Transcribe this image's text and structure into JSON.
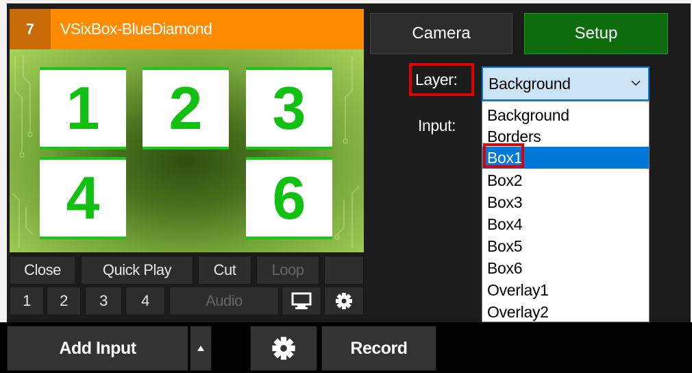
{
  "input_panel": {
    "number": "7",
    "title": "VSixBox-BlueDiamond",
    "preview_tiles": [
      "1",
      "2",
      "3",
      "4",
      "6"
    ]
  },
  "controls": {
    "row1": [
      "Close",
      "Quick Play",
      "Cut",
      "Loop"
    ],
    "row2": [
      "1",
      "2",
      "3",
      "4",
      "Audio"
    ]
  },
  "bottom_bar": {
    "add_input": "Add Input",
    "record": "Record"
  },
  "right_panel": {
    "camera_tab": "Camera",
    "setup_tab": "Setup",
    "layer_label": "Layer:",
    "input_label": "Input:",
    "layer_select": {
      "value": "Background",
      "options": [
        "Background",
        "Borders",
        "Box1",
        "Box2",
        "Box3",
        "Box4",
        "Box5",
        "Box6",
        "Overlay1",
        "Overlay2"
      ],
      "highlighted": "Box1"
    }
  },
  "colors": {
    "title_bar": "#ff8c00",
    "setup_active": "#0d6c0d",
    "selection": "#0078d7",
    "annotation": "#e00000",
    "tile_green": "#12c012"
  }
}
